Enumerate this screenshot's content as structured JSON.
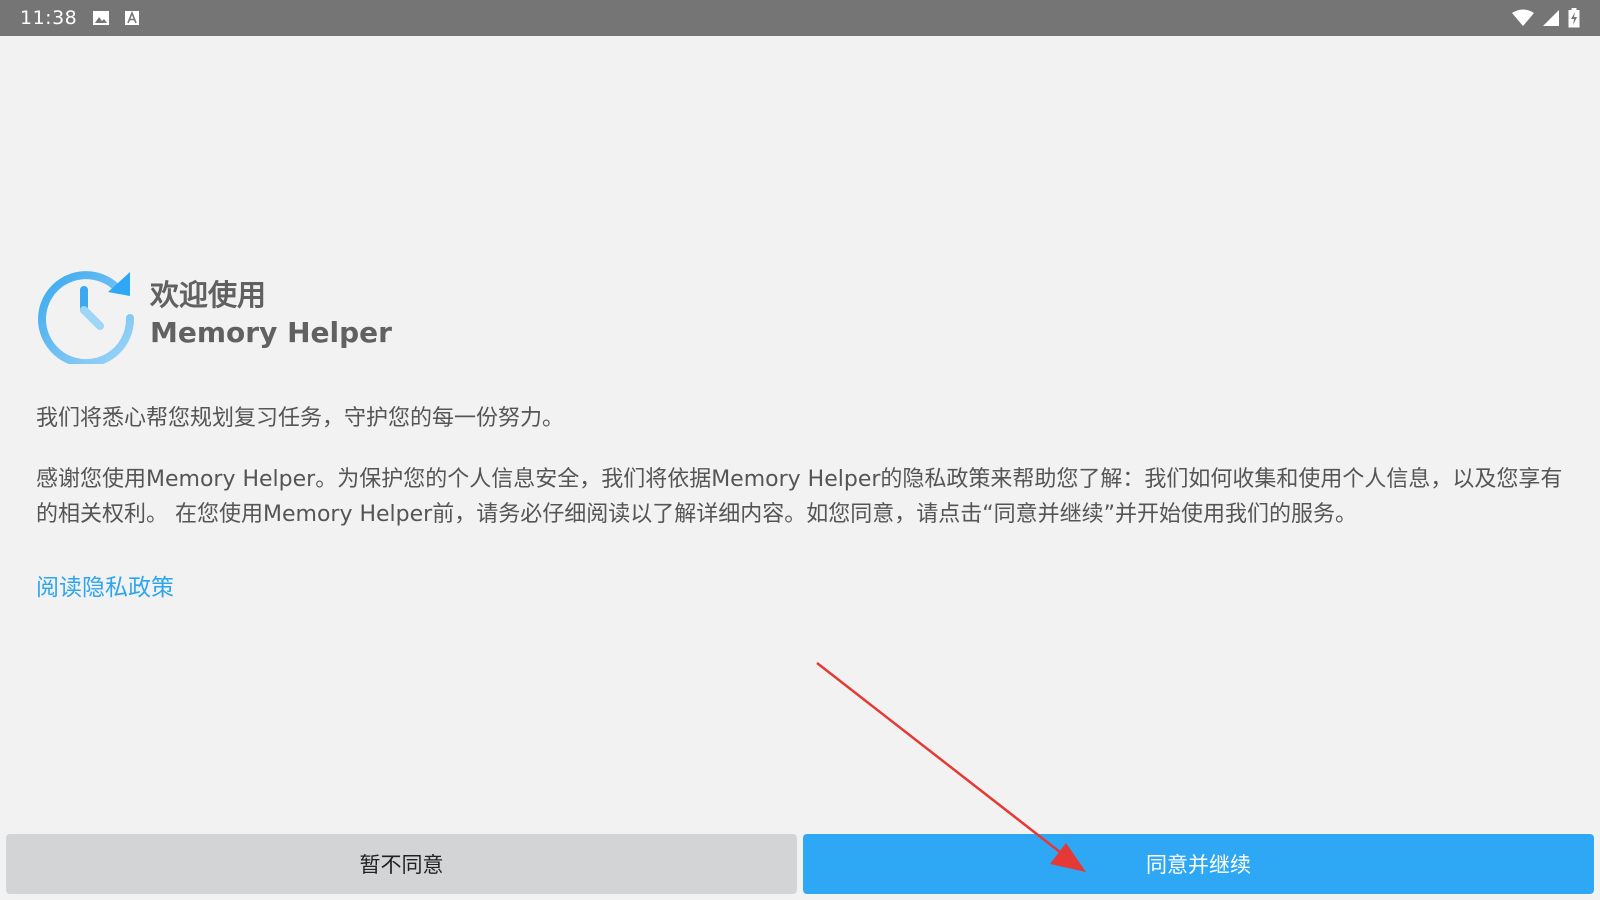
{
  "status_bar": {
    "time": "11:38",
    "left_icons": [
      "image-icon",
      "text-a-icon"
    ],
    "right_icons": [
      "wifi-icon",
      "signal-icon",
      "battery-charging-icon"
    ]
  },
  "header": {
    "logo_icon": "clock-refresh-icon",
    "welcome": "欢迎使用",
    "app_name": "Memory Helper"
  },
  "body": {
    "tagline": "我们将悉心帮您规划复习任务，守护您的每一份努力。",
    "description": "感谢您使用Memory Helper。为保护您的个人信息安全，我们将依据Memory Helper的隐私政策来帮助您了解：我们如何收集和使用个人信息，以及您享有的相关权利。 在您使用Memory Helper前，请务必仔细阅读以了解详细内容。如您同意，请点击“同意并继续”并开始使用我们的服务。",
    "privacy_link": "阅读隐私政策"
  },
  "buttons": {
    "disagree_label": "暂不同意",
    "agree_label": "同意并继续"
  },
  "colors": {
    "accent": "#2ea8f5",
    "link": "#2ea6ef",
    "status_bar": "#757575",
    "background": "#f2f2f2",
    "annotation_arrow": "#e53935"
  }
}
